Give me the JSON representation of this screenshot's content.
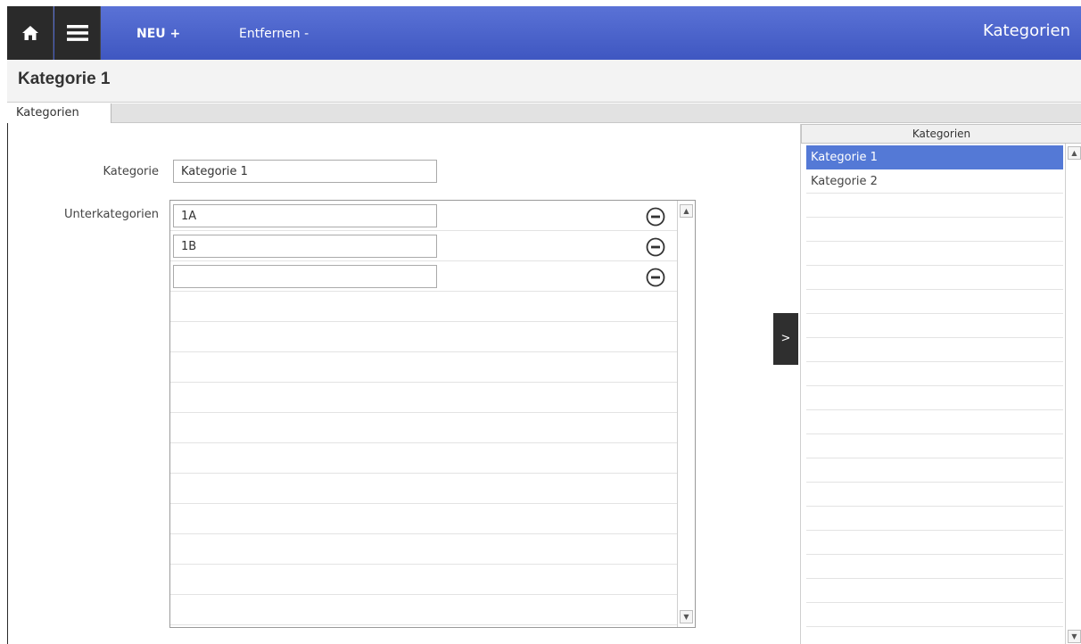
{
  "header": {
    "home_icon": "home-icon",
    "menu_icon": "hamburger-menu-icon",
    "new_label": "NEU +",
    "remove_label": "Entfernen -",
    "title": "Kategorien",
    "accent_color": "#4a63cc"
  },
  "page": {
    "title": "Kategorie 1"
  },
  "tabs": [
    {
      "label": "Kategorien",
      "active": true
    }
  ],
  "form": {
    "kategorie_label": "Kategorie",
    "kategorie_value": "Kategorie 1",
    "unterkategorien_label": "Unterkategorien",
    "unterkategorien": [
      {
        "value": "1A",
        "remove_icon": "minus-circle-icon"
      },
      {
        "value": "1B",
        "remove_icon": "minus-circle-icon"
      },
      {
        "value": "",
        "remove_icon": "minus-circle-icon"
      }
    ]
  },
  "toggle": {
    "label": ">"
  },
  "right_panel": {
    "header": "Kategorien",
    "items": [
      {
        "label": "Kategorie 1",
        "selected": true
      },
      {
        "label": "Kategorie 2",
        "selected": false
      }
    ],
    "selected_color": "#5479d6"
  },
  "scroll": {
    "up": "▲",
    "down": "▼"
  }
}
